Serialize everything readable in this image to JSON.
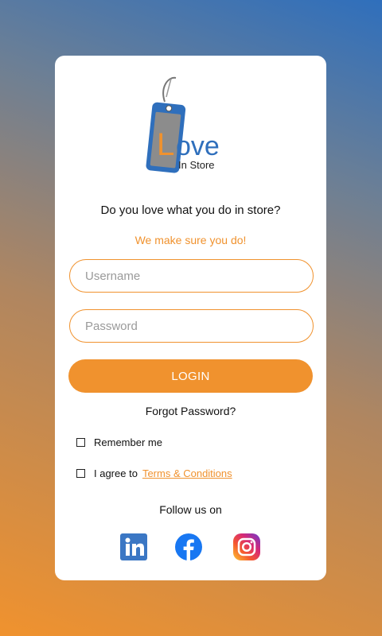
{
  "logo": {
    "brand_main": "Love",
    "brand_sub": "In Store",
    "icon": "price-tag-icon"
  },
  "tagline": "Do you love what you do in store?",
  "subtagline": "We make sure you do!",
  "username": {
    "placeholder": "Username",
    "value": ""
  },
  "password": {
    "placeholder": "Password",
    "value": ""
  },
  "login_label": "LOGIN",
  "forgot_label": "Forgot Password?",
  "remember_label": "Remember me",
  "agree_prefix": "I agree to",
  "terms_label": "Terms & Conditions",
  "follow_label": "Follow us on",
  "social": [
    {
      "icon": "linkedin-icon"
    },
    {
      "icon": "facebook-icon"
    },
    {
      "icon": "instagram-icon"
    }
  ],
  "colors": {
    "accent": "#f0922e",
    "tag_blue": "#2f6fbc",
    "facebook": "#1877f2",
    "linkedin": "#3b77c4"
  }
}
